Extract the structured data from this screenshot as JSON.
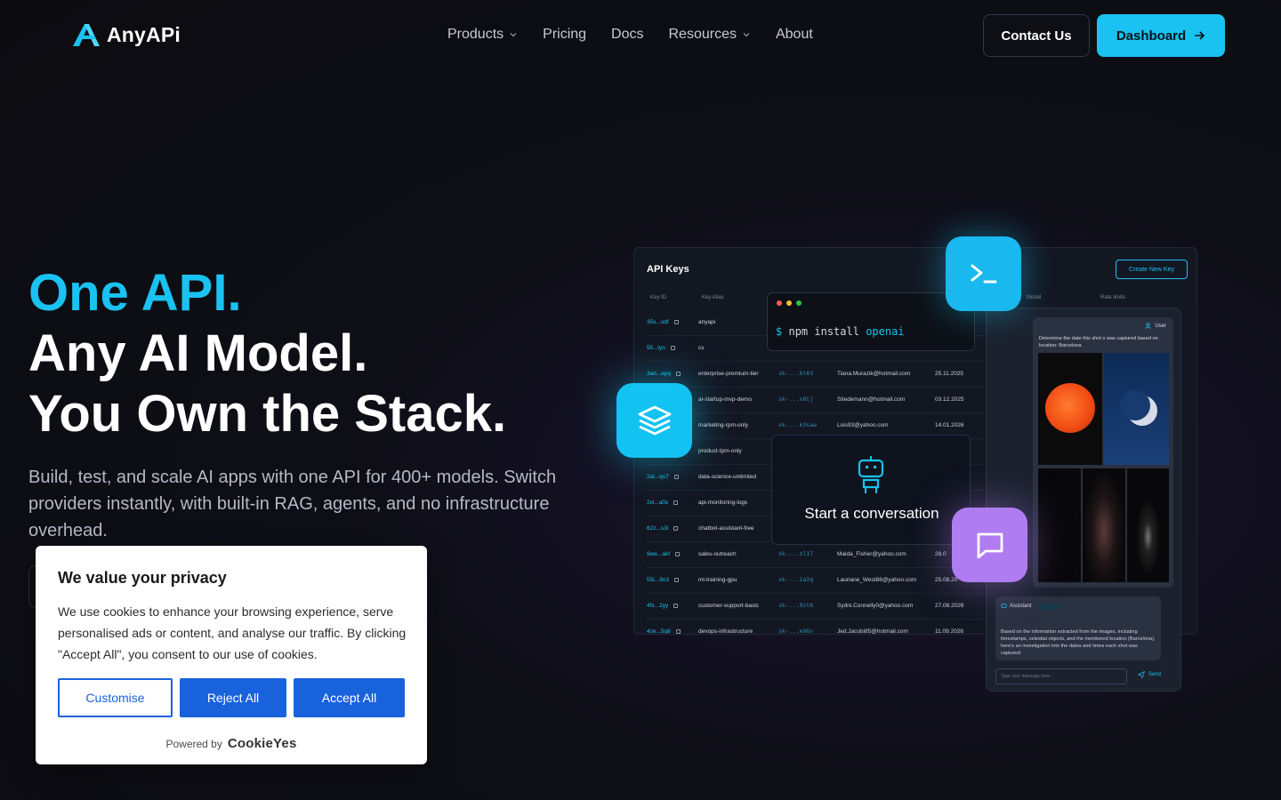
{
  "colors": {
    "accent": "#19c2f0",
    "purple": "#b07cf2",
    "cookie_blue": "#1863dc",
    "background": "#0e0e16"
  },
  "brand": {
    "name": "AnyAPi"
  },
  "nav": {
    "links": [
      {
        "label": "Products",
        "dropdown": true
      },
      {
        "label": "Pricing",
        "dropdown": false
      },
      {
        "label": "Docs",
        "dropdown": false
      },
      {
        "label": "Resources",
        "dropdown": true
      },
      {
        "label": "About",
        "dropdown": false
      }
    ],
    "contact_label": "Contact Us",
    "dashboard_label": "Dashboard"
  },
  "hero": {
    "line1": "One API.",
    "line2": "Any AI Model.",
    "line3": "You Own the Stack.",
    "subtitle": "Build, test, and scale AI apps with one API for 400+ models. Switch providers instantly, with built-in RAG, agents, and no infrastructure overhead."
  },
  "mock": {
    "title": "API Keys",
    "create_label": "Create New Key",
    "headers": {
      "key_id": "Key ID",
      "key_alias": "Key Alias",
      "model": "Model",
      "rate_limits": "Rate limits"
    },
    "rows": [
      {
        "id": "35s...sdf",
        "alias": "anyapi",
        "key": "",
        "email": "",
        "date": ""
      },
      {
        "id": "5fi...tyn",
        "alias": "cs",
        "key": "",
        "email": "",
        "date": ""
      },
      {
        "id": "3an...epq",
        "alias": "enterprise-premium-tier",
        "key": "sk-...6t83",
        "email": "Tiana.Murazik@hotmail.com",
        "date": "25.11.2025"
      },
      {
        "id": "",
        "alias": "ai-startup-mvp-demo",
        "key": "sk-...x8tj",
        "email": "Stiedemann@hotmail.com",
        "date": "03.12.2025"
      },
      {
        "id": "",
        "alias": "marketing-rpm-only",
        "key": "sk-...k3saw",
        "email": "Lois93@yahoo.com",
        "date": "14.01.2026"
      },
      {
        "id": "",
        "alias": "product-tpm-only",
        "key": "",
        "email": "",
        "date": ""
      },
      {
        "id": "2al...qs7",
        "alias": "data-science-unlimited",
        "key": "",
        "email": "",
        "date": ""
      },
      {
        "id": "2xl...a0s",
        "alias": "api-monitoring-logs",
        "key": "",
        "email": "",
        "date": ""
      },
      {
        "id": "62z...s3i",
        "alias": "chatbot-assistant-free",
        "key": "",
        "email": "",
        "date": ""
      },
      {
        "id": "9we...akf",
        "alias": "sales-outreach",
        "key": "sk-...zl17",
        "email": "Maida_Fisher@yahoo.com",
        "date": "28.0"
      },
      {
        "id": "55i...9n3",
        "alias": "ml-training-gpu",
        "key": "sk-...1a2q",
        "email": "Lauriane_West88@yahoo.com",
        "date": "25.08.20"
      },
      {
        "id": "4fx...2yy",
        "alias": "customer-support-basic",
        "key": "sk-...9it6",
        "email": "Sydni.Connelly0@yahoo.com",
        "date": "27.08.2026"
      },
      {
        "id": "4ze...5q8",
        "alias": "devops-infrastructure",
        "key": "sk-...e98v",
        "email": "Jed.Jacobi85@hotmail.com",
        "date": "11.09.2026"
      }
    ],
    "terminal": {
      "prompt": "$",
      "command": "npm install",
      "package": "openai"
    },
    "chat_popup_label": "Start a conversation",
    "user_label": "User",
    "user_message": "Determine the date this shot s was captured based on location: Barcelona",
    "assistant_label": "Assistant",
    "assistant_message": "Based on the information extracted from the images, including timestamps, celestial objects, and the mentioned location (Barcelona), here's an investigation into the dates and times each shot was captured:",
    "input_placeholder": "Type your message here...",
    "send_label": "Send"
  },
  "cookie": {
    "title": "We value your privacy",
    "text": "We use cookies to enhance your browsing experience, serve personalised ads or content, and analyse our traffic. By clicking \"Accept All\", you consent to our use of cookies.",
    "customise": "Customise",
    "reject": "Reject All",
    "accept": "Accept All",
    "powered_by": "Powered by",
    "brand": "CookieYes"
  }
}
